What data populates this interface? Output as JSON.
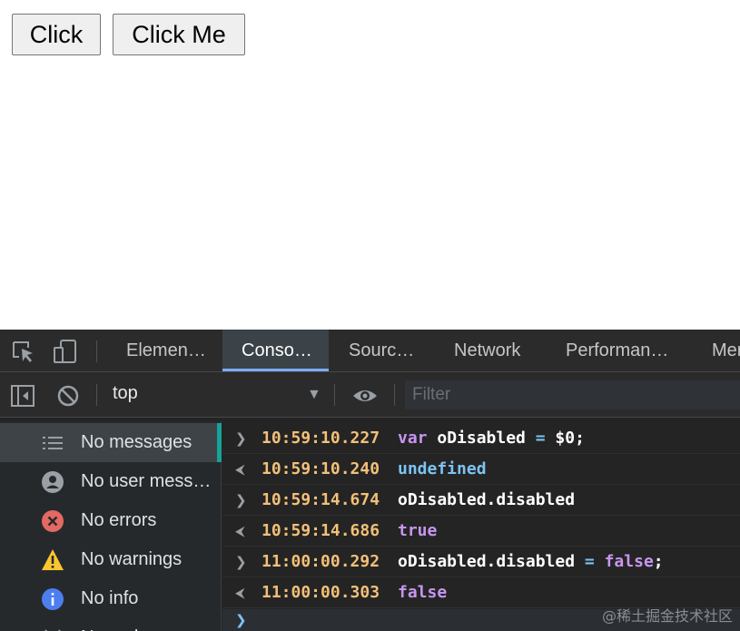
{
  "page": {
    "buttons": [
      "Click",
      "Click Me"
    ]
  },
  "devtools": {
    "tabs": [
      "Elemen…",
      "Conso…",
      "Sourc…",
      "Network",
      "Performan…",
      "Mer"
    ],
    "active_tab": "Conso…",
    "context": "top",
    "filter_placeholder": "Filter",
    "sidebar": [
      {
        "label": "No messages",
        "icon": "list-icon"
      },
      {
        "label": "No user mess…",
        "icon": "user-icon"
      },
      {
        "label": "No errors",
        "icon": "error-icon"
      },
      {
        "label": "No warnings",
        "icon": "warning-icon"
      },
      {
        "label": "No info",
        "icon": "info-icon"
      },
      {
        "label": "No verbose",
        "icon": "bug-icon"
      }
    ],
    "console": [
      {
        "dir": ">",
        "time": "10:59:10.227",
        "parts": [
          {
            "t": "var",
            "c": "kw"
          },
          {
            "t": " oDisabled ",
            "c": ""
          },
          {
            "t": "=",
            "c": "op"
          },
          {
            "t": " $0;",
            "c": ""
          }
        ]
      },
      {
        "dir": "<",
        "time": "10:59:10.240",
        "parts": [
          {
            "t": "undefined",
            "c": "blue"
          }
        ]
      },
      {
        "dir": ">",
        "time": "10:59:14.674",
        "parts": [
          {
            "t": "oDisabled.disabled",
            "c": ""
          }
        ]
      },
      {
        "dir": "<",
        "time": "10:59:14.686",
        "parts": [
          {
            "t": "true",
            "c": "purple"
          }
        ]
      },
      {
        "dir": ">",
        "time": "11:00:00.292",
        "parts": [
          {
            "t": "oDisabled.disabled ",
            "c": ""
          },
          {
            "t": "=",
            "c": "op"
          },
          {
            "t": " ",
            "c": ""
          },
          {
            "t": "false",
            "c": "purple"
          },
          {
            "t": ";",
            "c": ""
          }
        ]
      },
      {
        "dir": "<",
        "time": "11:00:00.303",
        "parts": [
          {
            "t": "false",
            "c": "purple"
          }
        ]
      }
    ],
    "watermark": "@稀土掘金技术社区"
  }
}
